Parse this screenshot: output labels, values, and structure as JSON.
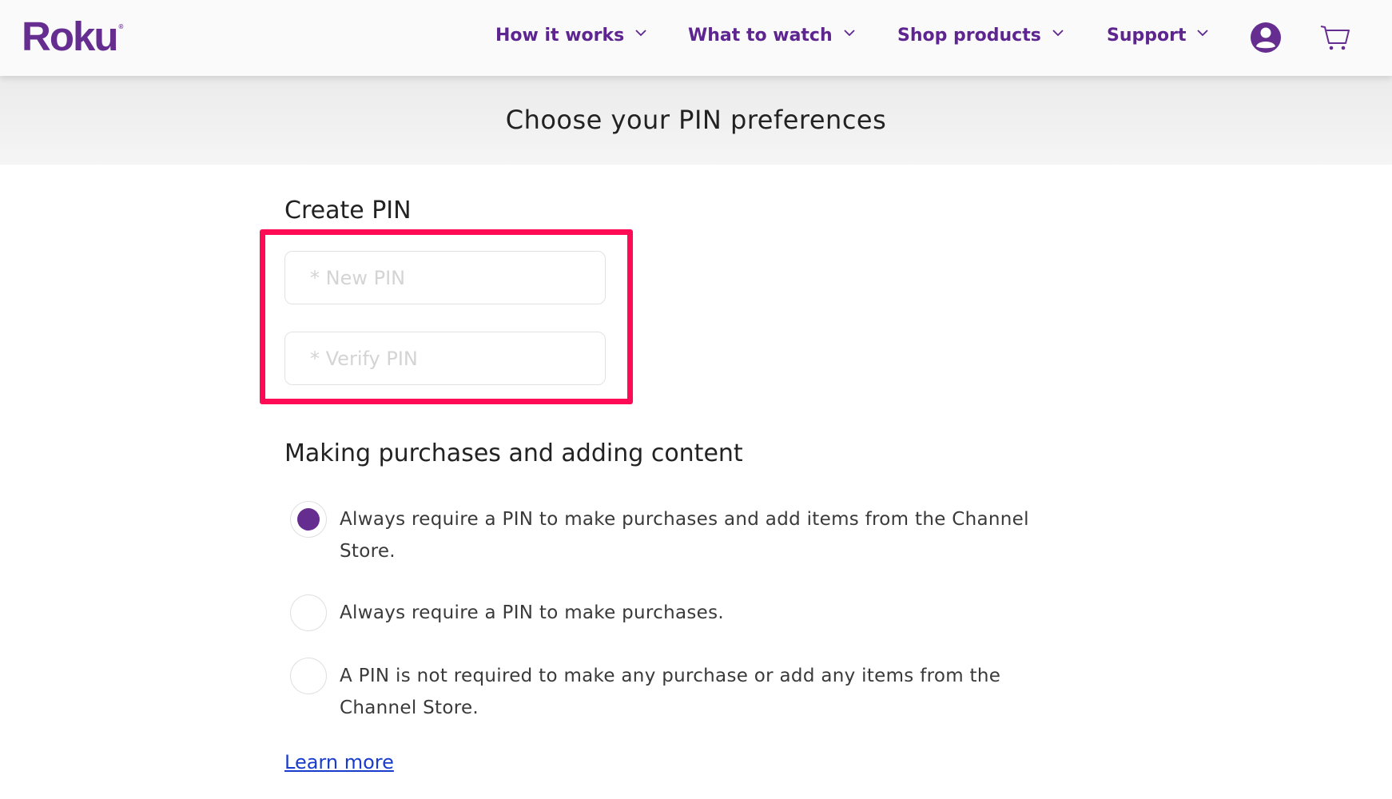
{
  "header": {
    "logo": "Roku",
    "logo_mark": "®",
    "nav": [
      {
        "label": "How it works",
        "icon": "chevron-down-icon"
      },
      {
        "label": "What to watch",
        "icon": "chevron-down-icon"
      },
      {
        "label": "Shop products",
        "icon": "chevron-down-icon"
      },
      {
        "label": "Support",
        "icon": "chevron-down-icon"
      }
    ],
    "account_icon": "user-account-icon",
    "cart_icon": "shopping-cart-icon"
  },
  "banner": {
    "title": "Choose your PIN preferences"
  },
  "create_pin": {
    "title": "Create PIN",
    "new_pin": {
      "placeholder": "* New PIN",
      "value": ""
    },
    "verify_pin": {
      "placeholder": "* Verify PIN",
      "value": ""
    },
    "highlight_color": "#ff0a54"
  },
  "purchases": {
    "title": "Making purchases and adding content",
    "selected_index": 0,
    "options": [
      {
        "label_line1": "Always require a PIN to make purchases and add items from the Channel",
        "label_line2": "Store.",
        "checked": true
      },
      {
        "label_line1": "Always require a PIN to make purchases.",
        "label_line2": "",
        "checked": false
      },
      {
        "label_line1": "A PIN is not required to make any purchase or add any items from the",
        "label_line2": "Channel Store.",
        "checked": false
      }
    ]
  },
  "learn_more": "Learn more",
  "colors": {
    "brand": "#662d91",
    "link": "#1a3ccc",
    "highlight": "#ff0a54"
  }
}
